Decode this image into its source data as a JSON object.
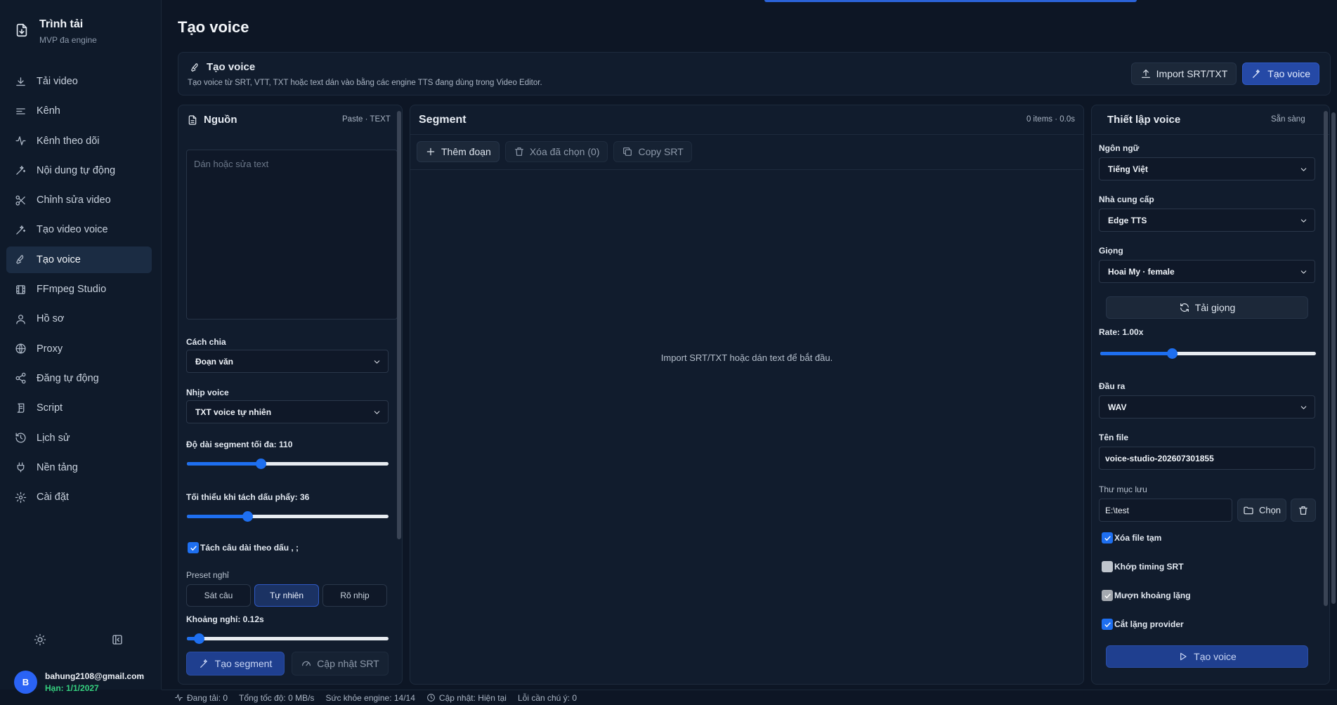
{
  "brand": {
    "title": "Trình tải",
    "subtitle": "MVP đa engine"
  },
  "nav": [
    {
      "label": "Tải video",
      "icon": "download-icon"
    },
    {
      "label": "Kênh",
      "icon": "list-icon"
    },
    {
      "label": "Kênh theo dõi",
      "icon": "activity-icon"
    },
    {
      "label": "Nội dung tự động",
      "icon": "magic-wand-icon"
    },
    {
      "label": "Chỉnh sửa video",
      "icon": "scissors-icon"
    },
    {
      "label": "Tạo video voice",
      "icon": "magic-wand-icon"
    },
    {
      "label": "Tạo voice",
      "icon": "microphone-icon",
      "active": true
    },
    {
      "label": "FFmpeg Studio",
      "icon": "film-icon"
    },
    {
      "label": "Hồ sơ",
      "icon": "user-icon"
    },
    {
      "label": "Proxy",
      "icon": "globe-icon"
    },
    {
      "label": "Đăng tự động",
      "icon": "share-icon"
    },
    {
      "label": "Script",
      "icon": "script-icon"
    },
    {
      "label": "Lịch sử",
      "icon": "history-icon"
    },
    {
      "label": "Nền tảng",
      "icon": "plug-icon"
    },
    {
      "label": "Cài đặt",
      "icon": "gear-icon"
    }
  ],
  "user": {
    "initial": "B",
    "email": "bahung2108@gmail.com",
    "expiry": "Hạn: 1/1/2027"
  },
  "page": {
    "title": "Tạo voice"
  },
  "header": {
    "title": "Tạo voice",
    "description": "Tạo voice từ SRT, VTT, TXT hoặc text dán vào bằng các engine TTS đang dùng trong Video Editor.",
    "import_label": "Import SRT/TXT",
    "create_label": "Tạo voice"
  },
  "source": {
    "title": "Nguồn",
    "meta": "Paste · TEXT",
    "placeholder": "Dán hoặc sửa text",
    "split_label": "Cách chia",
    "split_value": "Đoạn văn",
    "rhythm_label": "Nhịp voice",
    "rhythm_value": "TXT voice tự nhiên",
    "maxlen_label": "Độ dài segment tối đa: 110",
    "maxlen_value": 110,
    "maxlen_range": [
      0,
      300
    ],
    "minsplit_label": "Tối thiểu khi tách dấu phẩy: 36",
    "minsplit_value": 36,
    "minsplit_range": [
      0,
      120
    ],
    "split_punct_label": "Tách câu dài theo dấu , ;",
    "preset_label": "Preset nghỉ",
    "presets": [
      "Sát câu",
      "Tự nhiên",
      "Rõ nhịp"
    ],
    "pause_label": "Khoảng nghỉ: 0.12s",
    "pause_value": 0.12,
    "pause_range": [
      0,
      2
    ],
    "create_segment_label": "Tạo segment",
    "update_srt_label": "Cập nhật SRT"
  },
  "segment": {
    "title": "Segment",
    "meta": "0 items · 0.0s",
    "add_label": "Thêm đoạn",
    "delete_label": "Xóa đã chọn (0)",
    "copy_label": "Copy SRT",
    "empty_text": "Import SRT/TXT hoặc dán text để bắt đầu."
  },
  "voice": {
    "title": "Thiết lập voice",
    "status": "Sẵn sàng",
    "language_label": "Ngôn ngữ",
    "language_value": "Tiếng Việt",
    "provider_label": "Nhà cung cấp",
    "provider_value": "Edge TTS",
    "voice_label": "Giọng",
    "voice_value": "Hoai My · female",
    "load_voice_label": "Tải giọng",
    "rate_label": "Rate: 1.00x",
    "rate_value": 1.0,
    "rate_range": [
      0.5,
      2.0
    ],
    "output_label": "Đầu ra",
    "output_value": "WAV",
    "filename_label": "Tên file",
    "filename_value": "voice-studio-202607301855",
    "folder_label": "Thư mục lưu",
    "folder_value": "E:\\test",
    "choose_label": "Chọn",
    "opt_delete_temp": "Xóa file tạm",
    "opt_match_srt": "Khớp timing SRT",
    "opt_borrow_silence": "Mượn khoảng lặng",
    "opt_trim_silence": "Cắt lặng provider",
    "create_label": "Tạo voice"
  },
  "status": {
    "downloading": "Đang tải: 0",
    "speed": "Tổng tốc độ: 0 MB/s",
    "engine": "Sức khỏe engine: 14/14",
    "update": "Cập nhật: Hiện tại",
    "errors": "Lỗi cần chú ý: 0"
  },
  "colors": {
    "accent": "#2549a6",
    "active_nav": "#1b2c43",
    "checkbox": "#1e6ff0",
    "success": "#35d07f"
  }
}
